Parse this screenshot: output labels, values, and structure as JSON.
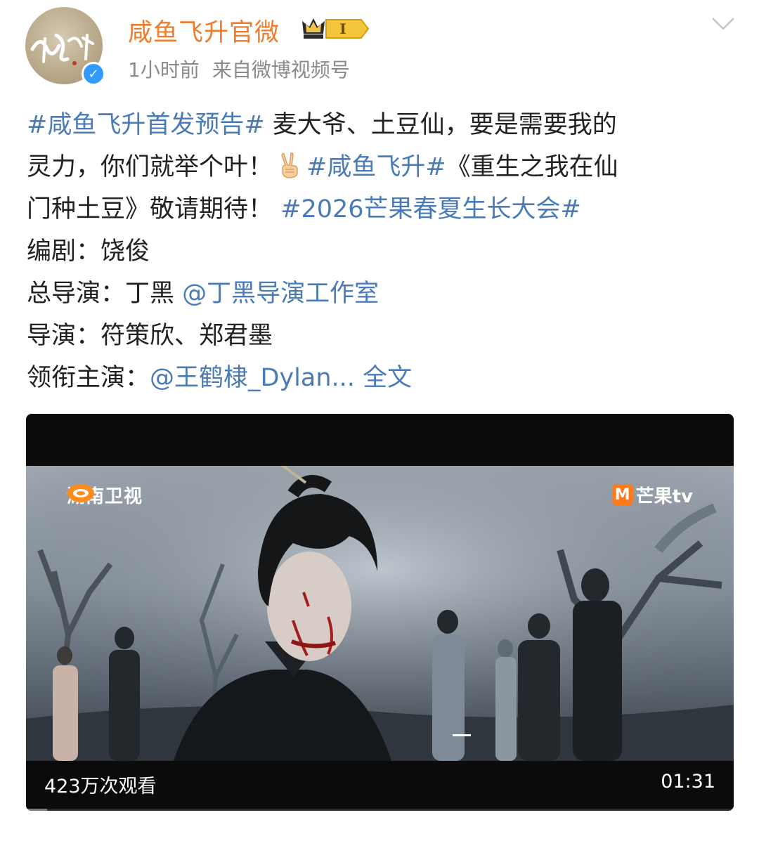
{
  "post": {
    "username": "咸鱼飞升官微",
    "member_level": "I",
    "time": "1小时前",
    "source": "来自微博视频号",
    "avatar_text": "咸鱼飞升",
    "lines": [
      [
        {
          "t": "tag",
          "v": "#咸鱼飞升首发预告#"
        },
        {
          "t": "text",
          "v": " 麦大爷、土豆仙，要是需要我的"
        }
      ],
      [
        {
          "t": "text",
          "v": "灵力，你们就举个叶！"
        },
        {
          "t": "emoji",
          "v": "victory-hand"
        },
        {
          "t": "tag",
          "v": "#咸鱼飞升#"
        },
        {
          "t": "text",
          "v": "《重生之我在仙"
        }
      ],
      [
        {
          "t": "text",
          "v": "门种土豆》敬请期待！ "
        },
        {
          "t": "tag",
          "v": "#2026芒果春夏生长大会#"
        }
      ],
      [
        {
          "t": "text",
          "v": "编剧：饶俊"
        }
      ],
      [
        {
          "t": "text",
          "v": "总导演：丁黑 "
        },
        {
          "t": "mention",
          "v": "@丁黑导演工作室"
        }
      ],
      [
        {
          "t": "text",
          "v": "导演：符策欣、郑君墨"
        }
      ],
      [
        {
          "t": "text",
          "v": "领衔主演："
        },
        {
          "t": "mention",
          "v": "@王鹤棣_Dylan..."
        },
        {
          "t": "text",
          "v": " "
        },
        {
          "t": "more",
          "v": "全文"
        }
      ]
    ]
  },
  "video": {
    "channel_left": "湖南卫视",
    "channel_right": "芒果tv",
    "channel_right_mark": "M",
    "views": "423万次观看",
    "duration": "01:31",
    "played_fraction": 0.03
  },
  "colors": {
    "username": "#f07b2b",
    "link": "#4a7bb7",
    "meta": "#8a8a8a",
    "verified": "#2f9bff",
    "badge_gold": "#e8b21a"
  },
  "icons": {
    "verified": "verified-check-icon",
    "badge": "crown-member-badge-icon",
    "menu": "chevron-down-icon",
    "emoji": "victory-hand-emoji"
  }
}
